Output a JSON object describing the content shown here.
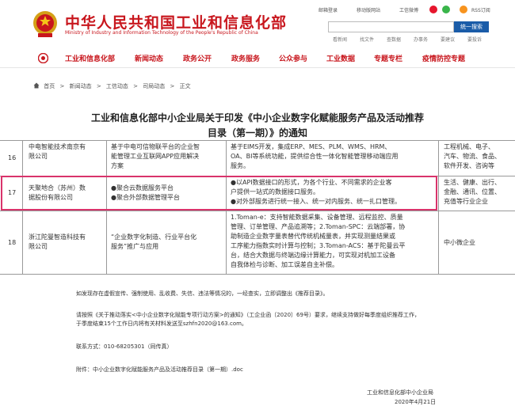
{
  "header": {
    "title": "中华人民共和国工业和信息化部",
    "subtitle": "Ministry of Industry and Information Technology of the People's Republic of China",
    "top_links": {
      "mail": "邮箱登录",
      "mobile": "移动版网站",
      "weibo": "工信微博",
      "rss": "RSS订阅"
    },
    "search_button": "统一搜索",
    "search_tags": [
      "看新闻",
      "找文件",
      "查数据",
      "办事务",
      "要建议",
      "要投诉"
    ]
  },
  "nav": {
    "items": [
      "工业和信息化部",
      "新闻动态",
      "政务公开",
      "政务服务",
      "公众参与",
      "工业数据",
      "专题专栏",
      "疫情防控专题"
    ]
  },
  "breadcrumb": {
    "items": [
      "首页",
      "新闻动态",
      "工信动态",
      "司局动态",
      "正文"
    ],
    "separator": ">"
  },
  "article": {
    "title_line1": "工业和信息化部中小企业局关于印发《中小企业数字化赋能服务产品及活动推荐",
    "title_line2": "目录（第一期）》的通知"
  },
  "table": {
    "rows": [
      {
        "num": "16",
        "company": [
          "中电智能技术南京有",
          "限公司"
        ],
        "product": [
          "基于中电可信物联平台的企业智",
          "能管理工业互联网APP应用解决",
          "方案"
        ],
        "desc": [
          "基于EIMS开发，集成ERP、MES、PLM、WMS、HRM、",
          "OA、BI等系统功能，提供综合性一体化智能管理移动端应用",
          "服务。"
        ],
        "industry": [
          "工程机械、电子、",
          "汽车、物流、食品、",
          "软件开发、咨询等"
        ]
      },
      {
        "num": "17",
        "company": [
          "天聚地合（苏州）数",
          "据股份有限公司"
        ],
        "product": [
          "●聚合云数据服务平台",
          "●聚合外部数据管理平台"
        ],
        "desc": [
          "●以API数据接口的形式，为各个行业、不同需求的企业客",
          "户提供一站式的数据接口服务。",
          "●对外部服务进行统一接入、统一对内服务、统一扎口管理。"
        ],
        "industry": [
          "生活、健康、出行、",
          "金融、通讯、位置、",
          "充值等行业企业"
        ]
      },
      {
        "num": "18",
        "company": [
          "浙江陀曼智造科技有",
          "限公司"
        ],
        "product": [
          "“企业数字化制造、行业平台化",
          "服务”推广与应用"
        ],
        "desc": [
          "1.Toman-e：支持智能数据采集、设备管理、远程监控、质量",
          "管理、订单管理、产品追溯等；2.Toman-SPC：云端部署，协",
          "助制造企业数字量表替代传统机械量表，并实现测量结果或",
          "工序能力指数实时计算与控制；3.Toman-ACS：基于陀曼云平",
          "台，结合大数据与终端边缘计算能力，可实现对机加工设备",
          "自我体检与诊断、加工误差自主补偿。"
        ],
        "industry": [
          "中小微企业"
        ]
      }
    ]
  },
  "body": {
    "p1": "如发现存在虚假宣传、强制使用、乱收费、失信、违法等情况的，一经查实，立即调整出《推荐目录》。",
    "p2_line1": "请按照《关于推动落实<中小企业数字化赋能专项行动方案>的通知》（工企业函〔2020〕69号）要求，继续支持做好每季度组织推荐工作，",
    "p2_line2": "于季度结束15个工作日内将有关材料发送至szhfn2020@163.com。",
    "contact": "联系方式：010-68205301（同传真）",
    "attachment": "附件：中小企业数字化赋能服务产品及活动推荐目录（第一期）.doc",
    "signer": "工业和信息化部中小企业局",
    "date": "2020年4月21日"
  },
  "colors": {
    "brand_red": "#c8161d",
    "search_blue": "#1a5ca8",
    "highlight_pink": "#d9336b"
  }
}
